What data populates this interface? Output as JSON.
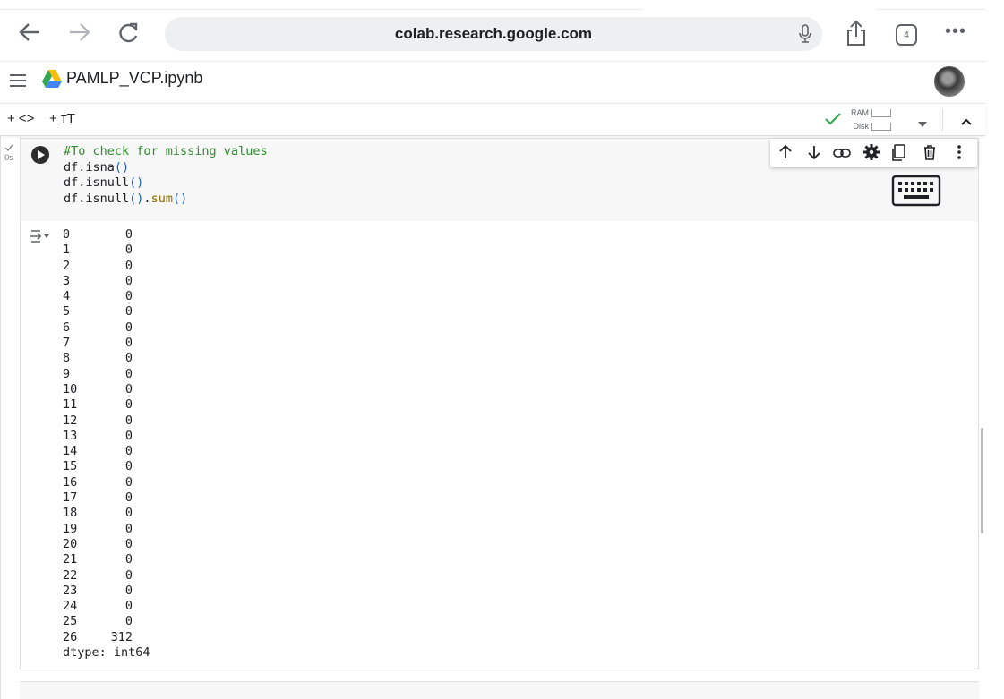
{
  "browser": {
    "url": "colab.research.google.com",
    "tab_count": "4",
    "more": "•••"
  },
  "header": {
    "notebook_title": "PAMLP_VCP.ipynb"
  },
  "toolbar": {
    "add_code": "+ <>",
    "add_text": "+ тT",
    "ram_label": "RAM",
    "disk_label": "Disk"
  },
  "cell": {
    "exec_time": "0s",
    "code_comment": "#To check for missing values",
    "line2_pre": "df.isna",
    "line3_pre": "df.isnull",
    "line4_pre": "df.isnull",
    "line4_dot": ".",
    "line4_fn": "sum",
    "parens": "()"
  },
  "output": {
    "rows": [
      {
        "index": "0",
        "value": "0"
      },
      {
        "index": "1",
        "value": "0"
      },
      {
        "index": "2",
        "value": "0"
      },
      {
        "index": "3",
        "value": "0"
      },
      {
        "index": "4",
        "value": "0"
      },
      {
        "index": "5",
        "value": "0"
      },
      {
        "index": "6",
        "value": "0"
      },
      {
        "index": "7",
        "value": "0"
      },
      {
        "index": "8",
        "value": "0"
      },
      {
        "index": "9",
        "value": "0"
      },
      {
        "index": "10",
        "value": "0"
      },
      {
        "index": "11",
        "value": "0"
      },
      {
        "index": "12",
        "value": "0"
      },
      {
        "index": "13",
        "value": "0"
      },
      {
        "index": "14",
        "value": "0"
      },
      {
        "index": "15",
        "value": "0"
      },
      {
        "index": "16",
        "value": "0"
      },
      {
        "index": "17",
        "value": "0"
      },
      {
        "index": "18",
        "value": "0"
      },
      {
        "index": "19",
        "value": "0"
      },
      {
        "index": "20",
        "value": "0"
      },
      {
        "index": "21",
        "value": "0"
      },
      {
        "index": "22",
        "value": "0"
      },
      {
        "index": "23",
        "value": "0"
      },
      {
        "index": "24",
        "value": "0"
      },
      {
        "index": "25",
        "value": "0"
      },
      {
        "index": "26",
        "value": "312"
      }
    ],
    "dtype": "dtype: int64"
  }
}
